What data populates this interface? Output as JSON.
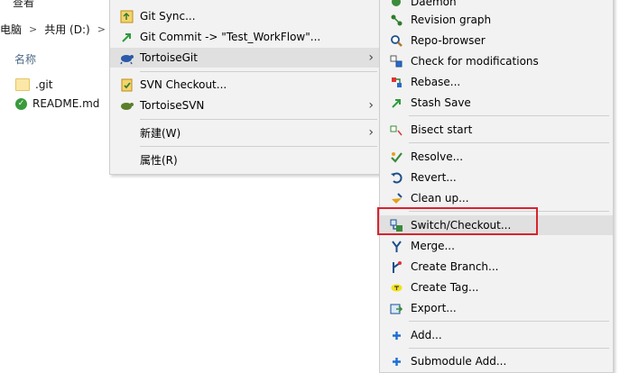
{
  "explorer": {
    "top_label": "查看",
    "breadcrumb": [
      "电脑",
      "共用 (D:)"
    ],
    "breadcrumb_sep": ">",
    "column_header": "名称",
    "files": [
      ".git",
      "README.md"
    ]
  },
  "left_menu": {
    "items": [
      {
        "label": "Git Sync...",
        "icon": "git-sync-icon"
      },
      {
        "label": "Git Commit -> \"Test_WorkFlow\"...",
        "icon": "git-commit-icon"
      },
      {
        "label": "TortoiseGit",
        "icon": "tortoisegit-icon",
        "submenu": true,
        "highlighted": true
      },
      {
        "label": "SVN Checkout...",
        "icon": "svn-checkout-icon"
      },
      {
        "label": "TortoiseSVN",
        "icon": "tortoisesvn-icon",
        "submenu": true
      },
      {
        "label": "新建(W)",
        "submenu": true
      },
      {
        "label": "属性(R)"
      }
    ]
  },
  "right_menu": {
    "items": [
      {
        "label": "Daemon",
        "icon": "daemon-icon"
      },
      {
        "label": "Revision graph",
        "icon": "revision-graph-icon"
      },
      {
        "label": "Repo-browser",
        "icon": "repo-browser-icon"
      },
      {
        "label": "Check for modifications",
        "icon": "check-modifications-icon"
      },
      {
        "label": "Rebase...",
        "icon": "rebase-icon"
      },
      {
        "label": "Stash Save",
        "icon": "stash-save-icon"
      },
      {
        "label": "Bisect start",
        "icon": "bisect-icon"
      },
      {
        "label": "Resolve...",
        "icon": "resolve-icon"
      },
      {
        "label": "Revert...",
        "icon": "revert-icon"
      },
      {
        "label": "Clean up...",
        "icon": "cleanup-icon"
      },
      {
        "label": "Switch/Checkout...",
        "icon": "switch-checkout-icon",
        "highlighted": true
      },
      {
        "label": "Merge...",
        "icon": "merge-icon"
      },
      {
        "label": "Create Branch...",
        "icon": "create-branch-icon"
      },
      {
        "label": "Create Tag...",
        "icon": "create-tag-icon"
      },
      {
        "label": "Export...",
        "icon": "export-icon"
      },
      {
        "label": "Add...",
        "icon": "add-icon"
      },
      {
        "label": "Submodule Add...",
        "icon": "submodule-add-icon"
      }
    ]
  },
  "colors": {
    "menu_bg": "#f2f2f2",
    "highlight_bg": "#e0e0e0",
    "annotation_red": "#d9232d"
  }
}
